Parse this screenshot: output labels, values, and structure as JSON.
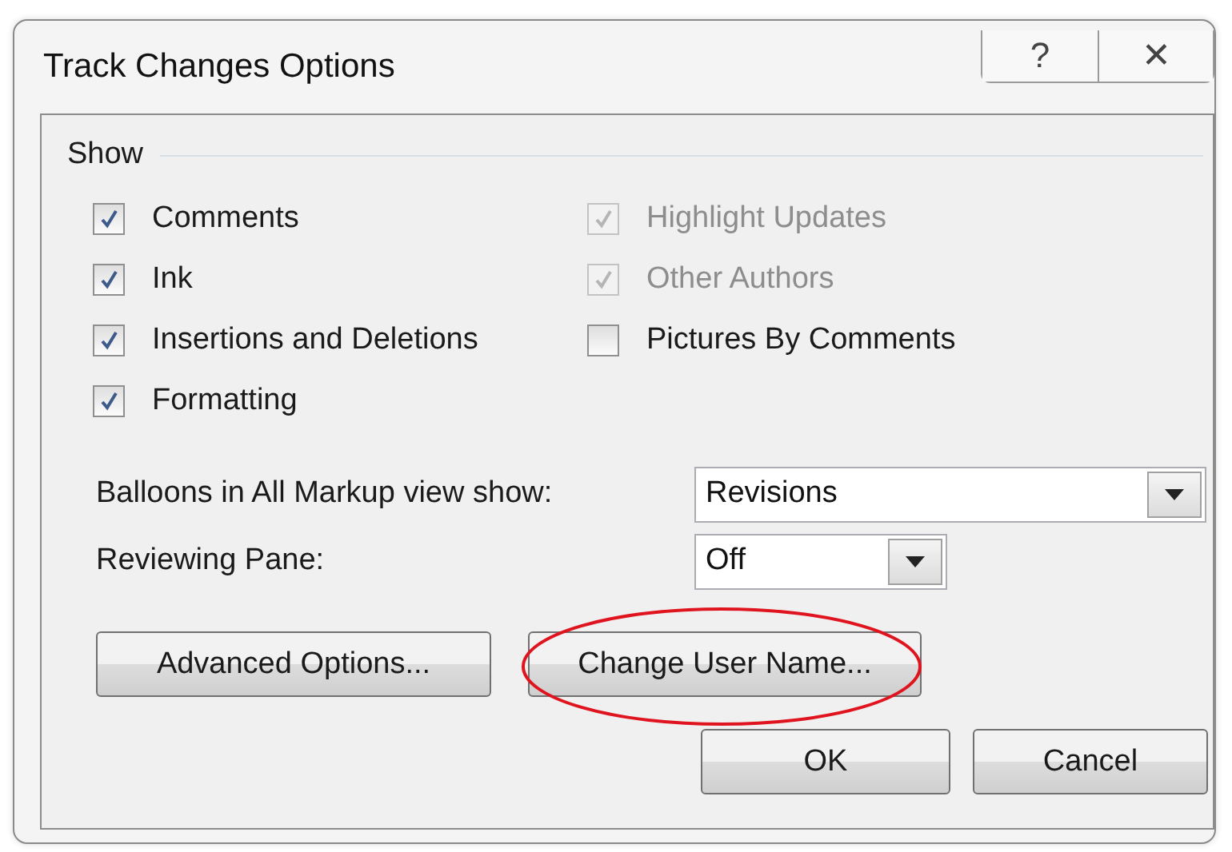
{
  "window": {
    "title": "Track Changes Options",
    "controls": [
      "?",
      "✕"
    ]
  },
  "show": {
    "label": "Show",
    "left_column": [
      {
        "label": "Comments",
        "checked": true,
        "disabled": false
      },
      {
        "label": "Ink",
        "checked": true,
        "disabled": false
      },
      {
        "label": "Insertions and Deletions",
        "checked": true,
        "disabled": false
      },
      {
        "label": "Formatting",
        "checked": true,
        "disabled": false
      }
    ],
    "right_column": [
      {
        "label": "Highlight Updates",
        "checked": true,
        "disabled": true
      },
      {
        "label": "Other Authors",
        "checked": true,
        "disabled": true
      },
      {
        "label": "Pictures By Comments",
        "checked": false,
        "disabled": false
      }
    ]
  },
  "dropdowns": [
    {
      "label": "Balloons in All Markup view show:",
      "value": "Revisions",
      "wide": true
    },
    {
      "label": "Reviewing Pane:",
      "value": "Off",
      "wide": false
    }
  ],
  "buttons": [
    {
      "label": "Advanced Options...",
      "circled": false
    },
    {
      "label": "Change User Name...",
      "circled": true
    }
  ],
  "footer_buttons": [
    "OK",
    "Cancel"
  ]
}
